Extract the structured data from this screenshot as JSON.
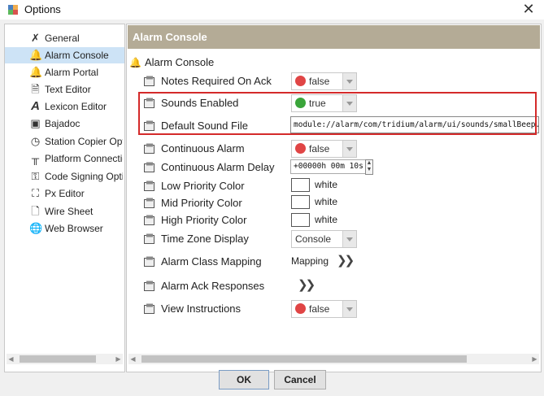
{
  "window": {
    "title": "Options"
  },
  "sidebar": {
    "items": [
      {
        "label": "General",
        "icon": "compass-icon"
      },
      {
        "label": "Alarm Console",
        "icon": "bell-icon",
        "selected": true
      },
      {
        "label": "Alarm Portal",
        "icon": "bell-icon"
      },
      {
        "label": "Text Editor",
        "icon": "text-file-icon"
      },
      {
        "label": "Lexicon Editor",
        "icon": "letter-a-icon"
      },
      {
        "label": "Bajadoc",
        "icon": "book-icon"
      },
      {
        "label": "Station Copier Opt",
        "icon": "clock-icon"
      },
      {
        "label": "Platform Connectic",
        "icon": "plug-icon"
      },
      {
        "label": "Code Signing Opti",
        "icon": "certificate-icon"
      },
      {
        "label": "Px Editor",
        "icon": "px-editor-icon"
      },
      {
        "label": "Wire Sheet",
        "icon": "wire-sheet-icon"
      },
      {
        "label": "Web Browser",
        "icon": "globe-icon"
      }
    ]
  },
  "content": {
    "header": "Alarm Console",
    "section_title": "Alarm Console",
    "properties": {
      "notes_required": {
        "label": "Notes Required On Ack",
        "value": "false",
        "color": "#e04545"
      },
      "sounds_enabled": {
        "label": "Sounds Enabled",
        "value": "true",
        "color": "#3aa53a"
      },
      "default_sound_file": {
        "label": "Default Sound File",
        "value": "module://alarm/com/tridium/alarm/ui/sounds/smallBeep.wav"
      },
      "continuous_alarm": {
        "label": "Continuous Alarm",
        "value": "false",
        "color": "#e04545"
      },
      "continuous_alarm_delay": {
        "label": "Continuous Alarm Delay",
        "value": "+00000h 00m 10s"
      },
      "low_priority_color": {
        "label": "Low Priority Color",
        "value": "white"
      },
      "mid_priority_color": {
        "label": "Mid Priority Color",
        "value": "white"
      },
      "high_priority_color": {
        "label": "High Priority Color",
        "value": "white"
      },
      "time_zone_display": {
        "label": "Time Zone Display",
        "value": "Console"
      },
      "alarm_class_mapping": {
        "label": "Alarm Class Mapping",
        "value": "Mapping"
      },
      "alarm_ack_responses": {
        "label": "Alarm Ack Responses"
      },
      "view_instructions": {
        "label": "View Instructions",
        "value": "false",
        "color": "#e04545"
      }
    }
  },
  "buttons": {
    "ok": "OK",
    "cancel": "Cancel"
  },
  "colors": {
    "header_bg": "#b4ab96",
    "selection": "#cde3f6",
    "highlight_border": "#d42a2a"
  }
}
